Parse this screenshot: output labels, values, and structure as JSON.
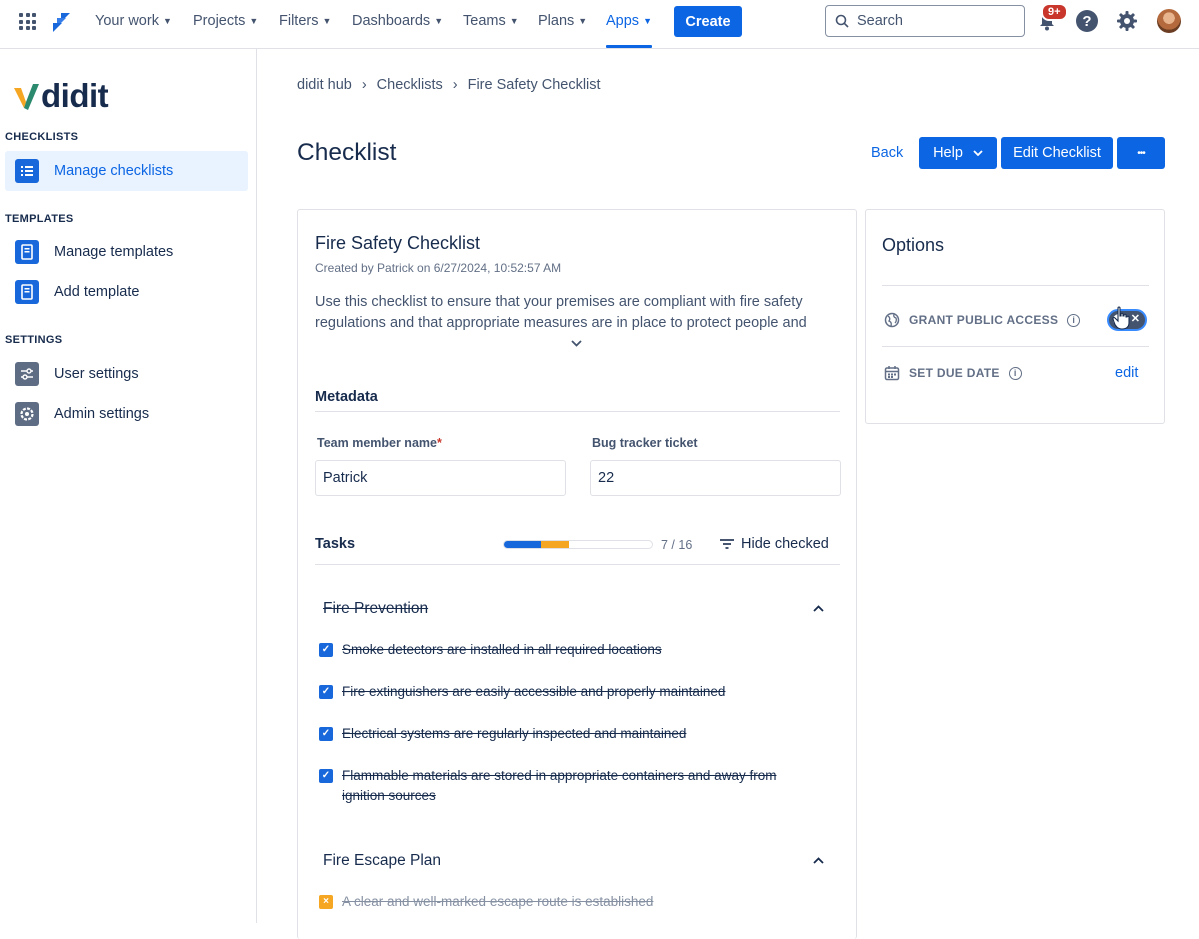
{
  "topnav": {
    "items": [
      {
        "label": "Your work"
      },
      {
        "label": "Projects"
      },
      {
        "label": "Filters"
      },
      {
        "label": "Dashboards"
      },
      {
        "label": "Teams"
      },
      {
        "label": "Plans"
      },
      {
        "label": "Apps"
      }
    ],
    "active_item": "Apps",
    "create_label": "Create",
    "search_placeholder": "Search",
    "notifications_badge": "9+",
    "help_glyph": "?",
    "icons": [
      "app-switcher-icon",
      "jira-logo-icon",
      "search-icon",
      "notification-bell-icon",
      "help-icon",
      "settings-gear-icon",
      "user-avatar"
    ]
  },
  "sidebar": {
    "brand": "didit",
    "sections": [
      {
        "title": "CHECKLISTS",
        "items": [
          {
            "label": "Manage checklists",
            "active": true,
            "icon": "checklist-icon"
          }
        ]
      },
      {
        "title": "TEMPLATES",
        "items": [
          {
            "label": "Manage templates",
            "icon": "template-icon"
          },
          {
            "label": "Add template",
            "icon": "template-icon"
          }
        ]
      },
      {
        "title": "SETTINGS",
        "items": [
          {
            "label": "User settings",
            "icon": "sliders-icon"
          },
          {
            "label": "Admin settings",
            "icon": "gear-icon"
          }
        ]
      }
    ]
  },
  "main": {
    "breadcrumb": [
      "didit hub",
      "Checklists",
      "Fire Safety Checklist"
    ],
    "breadcrumb_separator": "›",
    "page_title": "Checklist",
    "actions": {
      "back": "Back",
      "help": "Help",
      "edit": "Edit Checklist",
      "more": "•••"
    },
    "checklist": {
      "title": "Fire Safety Checklist",
      "created": "Created by Patrick on 6/27/2024, 10:52:57 AM",
      "description": "Use this checklist to ensure that your premises are compliant with fire safety regulations and that appropriate measures are in place to protect people and"
    },
    "metadata": {
      "title": "Metadata",
      "fields": [
        {
          "label": "Team member name",
          "required": "*",
          "value": "Patrick"
        },
        {
          "label": "Bug tracker ticket",
          "value": "22"
        }
      ]
    },
    "tasks": {
      "title": "Tasks",
      "progress_text": "7 / 16",
      "progress": {
        "done_fraction": 0.25,
        "partial_fraction": 0.1875
      },
      "hide_checked_label": "Hide checked",
      "groups": [
        {
          "title": "Fire Prevention",
          "completed": true,
          "items": [
            {
              "text": "Smoke detectors are installed in all required locations",
              "state": "checked"
            },
            {
              "text": "Fire extinguishers are easily accessible and properly maintained",
              "state": "checked"
            },
            {
              "text": "Electrical systems are regularly inspected and maintained",
              "state": "checked"
            },
            {
              "text": "Flammable materials are stored in appropriate containers and away from ignition sources",
              "state": "checked"
            }
          ]
        },
        {
          "title": "Fire Escape Plan",
          "completed": false,
          "items": [
            {
              "text": "A clear and well-marked escape route is established",
              "state": "not-applicable"
            }
          ]
        }
      ]
    }
  },
  "options": {
    "title": "Options",
    "grant_public_access": "GRANT PUBLIC ACCESS",
    "grant_public_access_enabled": false,
    "set_due_date": "SET DUE DATE",
    "edit_label": "edit",
    "info_glyph": "i",
    "colors": {
      "accent": "#0c66e4",
      "partial": "#f5a623",
      "required": "#c9372c"
    }
  }
}
